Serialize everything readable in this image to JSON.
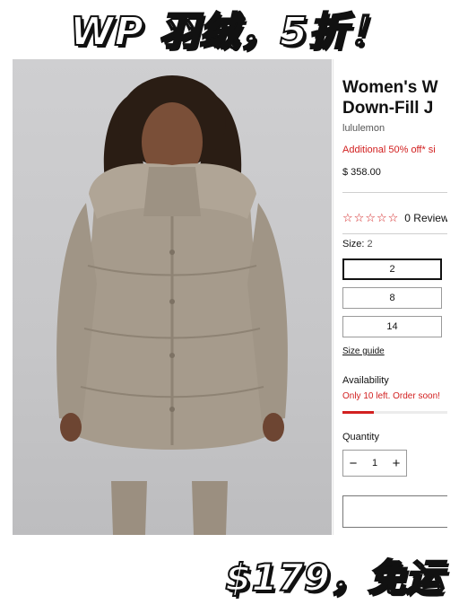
{
  "banner": {
    "headline": "WP 羽绒，5折！",
    "deal": "$179，免运"
  },
  "product": {
    "title_line1": "Women's W",
    "title_line2": "Down-Fill J",
    "brand": "lululemon",
    "promo": "Additional 50% off* si",
    "price": "$ 358.00"
  },
  "reviews": {
    "star_glyph": "☆",
    "stars": 0,
    "star_count": 5,
    "label": "0 Review"
  },
  "size": {
    "label": "Size:",
    "selected": "2",
    "options": [
      "2",
      "8",
      "14"
    ],
    "guide": "Size guide"
  },
  "availability": {
    "label": "Availability",
    "status": "Only 10 left. Order soon!",
    "stock_fraction": 0.3
  },
  "quantity": {
    "label": "Quantity",
    "value": "1",
    "minus": "−",
    "plus": "+"
  },
  "colors": {
    "accent": "#d22020",
    "jacket": "#a69b8c",
    "background": "#c9c9cb"
  }
}
